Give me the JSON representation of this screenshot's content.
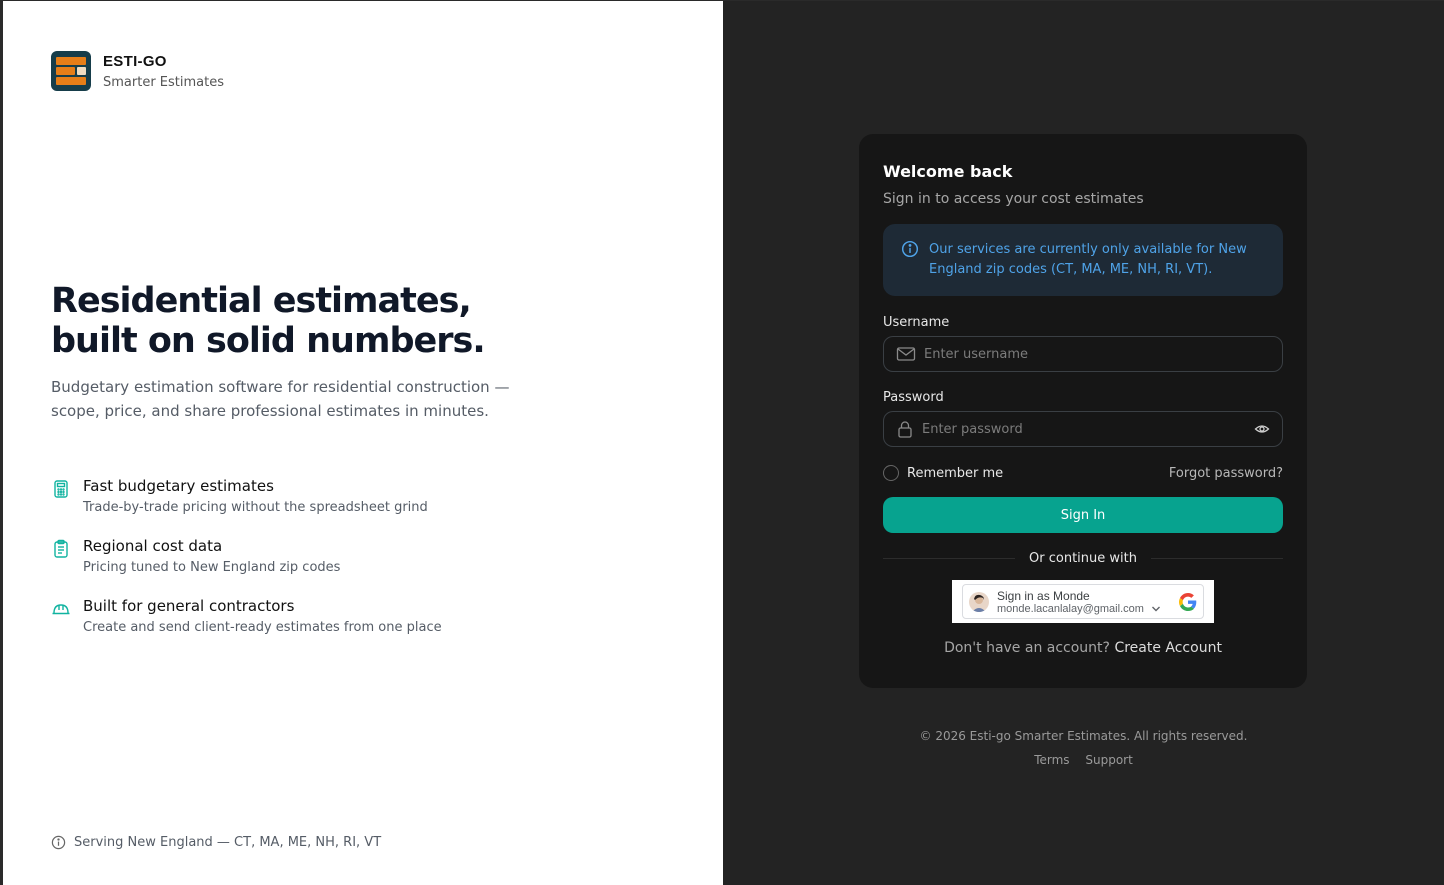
{
  "brand": {
    "name": "ESTI-GO",
    "tagline": "Smarter Estimates"
  },
  "hero": {
    "title_line1": "Residential estimates,",
    "title_line2": "built on solid numbers.",
    "description": "Budgetary estimation software for residential construction — scope, price, and share professional estimates in minutes."
  },
  "features": [
    {
      "icon": "calculator-icon",
      "title": "Fast budgetary estimates",
      "desc": "Trade-by-trade pricing without the spreadsheet grind"
    },
    {
      "icon": "clipboard-list-icon",
      "title": "Regional cost data",
      "desc": "Pricing tuned to New England zip codes"
    },
    {
      "icon": "hard-hat-icon",
      "title": "Built for general contractors",
      "desc": "Create and send client-ready estimates from one place"
    }
  ],
  "serving": "Serving New England — CT, MA, ME, NH, RI, VT",
  "login": {
    "title": "Welcome back",
    "subtitle": "Sign in to access your cost estimates",
    "notice": "Our services are currently only available for New England zip codes (CT, MA, ME, NH, RI, VT).",
    "username_label": "Username",
    "username_placeholder": "Enter username",
    "password_label": "Password",
    "password_placeholder": "Enter password",
    "remember_label": "Remember me",
    "forgot_label": "Forgot password?",
    "signin_label": "Sign In",
    "divider_label": "Or continue with",
    "google": {
      "name": "Sign in as Monde",
      "email": "monde.lacanlalay@gmail.com"
    },
    "signup_prompt": "Don't have an account?",
    "signup_link": "Create Account"
  },
  "footer": {
    "copyright": "© 2026 Esti-go Smarter Estimates. All rights reserved.",
    "terms": "Terms",
    "support": "Support"
  },
  "colors": {
    "accent": "#07a38f",
    "notice_text": "#4fa3e8",
    "logo_orange": "#e67e18",
    "logo_bg": "#163d4a"
  }
}
